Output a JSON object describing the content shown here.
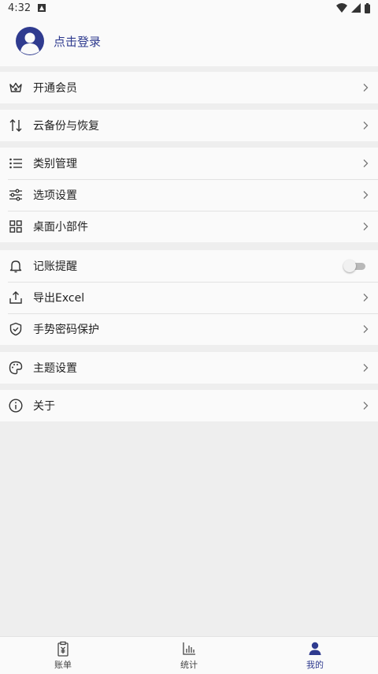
{
  "status_bar": {
    "time": "4:32"
  },
  "profile": {
    "login_text": "点击登录"
  },
  "menu": {
    "vip": "开通会员",
    "cloud_backup": "云备份与恢复",
    "category": "类别管理",
    "options": "选项设置",
    "widget": "桌面小部件",
    "reminder": "记账提醒",
    "export_excel": "导出Excel",
    "gesture_lock": "手势密码保护",
    "theme": "主题设置",
    "about": "关于"
  },
  "reminder_enabled": false,
  "bottom_nav": {
    "bills": "账单",
    "stats": "统计",
    "mine": "我的"
  },
  "colors": {
    "accent": "#2f3b8f",
    "background": "#eeeeee",
    "card": "#fafafa"
  }
}
